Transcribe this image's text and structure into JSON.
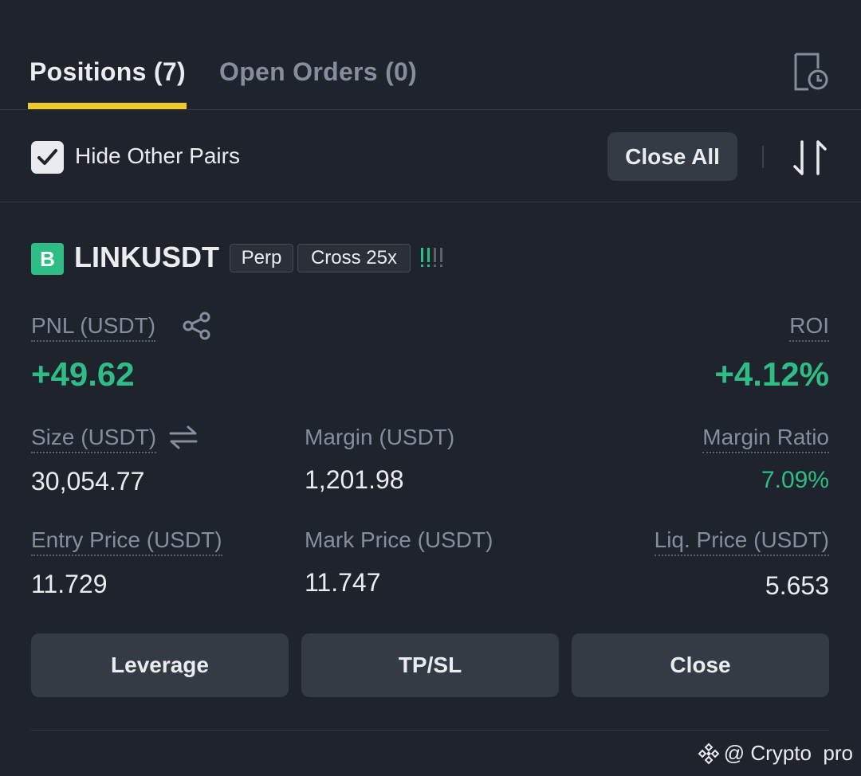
{
  "tabs": {
    "positions": "Positions (7)",
    "open_orders": "Open Orders (0)"
  },
  "toolbar": {
    "hide_other_pairs": "Hide Other Pairs",
    "hide_other_pairs_checked": true,
    "close_all": "Close All"
  },
  "position": {
    "side": "B",
    "symbol": "LINKUSDT",
    "contract_type": "Perp",
    "margin_mode": "Cross 25x",
    "pnl_label": "PNL (USDT)",
    "pnl_value": "+49.62",
    "roi_label": "ROI",
    "roi_value": "+4.12%",
    "size_label": "Size (USDT)",
    "size_value": "30,054.77",
    "margin_label": "Margin (USDT)",
    "margin_value": "1,201.98",
    "margin_ratio_label": "Margin Ratio",
    "margin_ratio_value": "7.09%",
    "entry_label": "Entry Price (USDT)",
    "entry_value": "11.729",
    "mark_label": "Mark Price (USDT)",
    "mark_value": "11.747",
    "liq_label": "Liq. Price (USDT)",
    "liq_value": "5.653"
  },
  "actions": {
    "leverage": "Leverage",
    "tpsl": "TP/SL",
    "close": "Close"
  },
  "watermark": {
    "text": "@ Crypto  pro"
  },
  "colors": {
    "background": "#1f232b",
    "accent_yellow": "#f0c92b",
    "profit_green": "#2ebd85",
    "button_bg": "#353b45",
    "muted_text": "#848e9c"
  },
  "icons": {
    "history": "order-history-icon",
    "sort": "sort-arrows-icon",
    "share": "share-icon",
    "swap": "swap-arrows-icon",
    "adl": "adl-indicator-bars-icon",
    "check": "checkmark-icon",
    "logo": "binance-logo-icon"
  }
}
